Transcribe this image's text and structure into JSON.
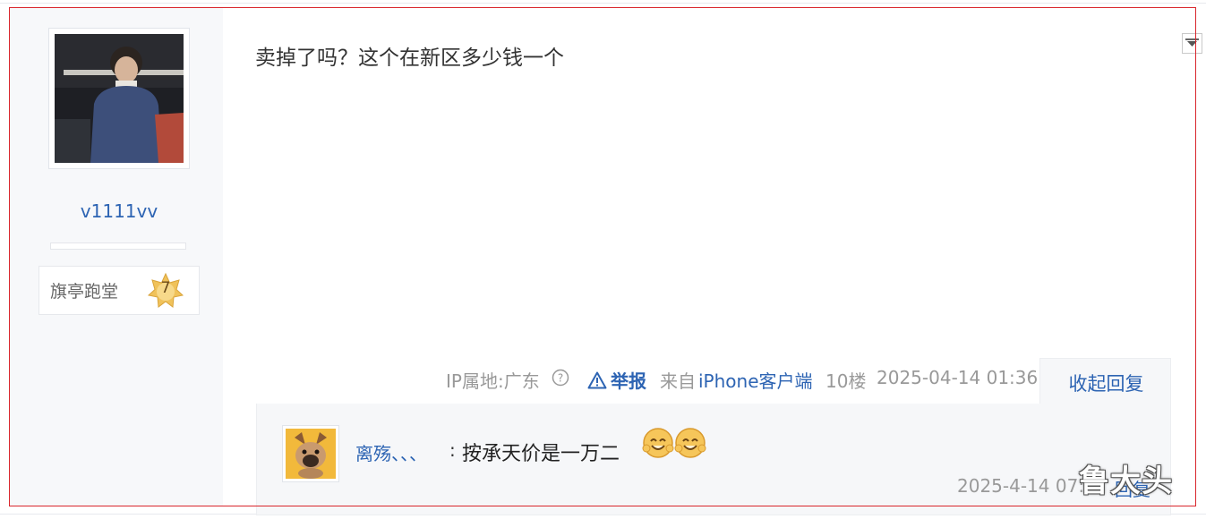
{
  "user": {
    "username": "v1111vv",
    "progress": 0.0,
    "level_title": "旗亭跑堂",
    "level_number": "7"
  },
  "post": {
    "content": "卖掉了吗？这个在新区多少钱一个",
    "meta": {
      "ip_location": "IP属地:广东",
      "help_icon": "question-circle-icon",
      "report": "举报",
      "source_prefix": "来自",
      "source": "iPhone客户端",
      "floor": "10楼",
      "time": "2025-04-14 01:36"
    },
    "collapse_reply_label": "收起回复"
  },
  "replies": [
    {
      "username": "离殇、、、",
      "colon": ":",
      "text": "按承天价是一万二",
      "emojis": [
        "smile-emoji",
        "smile-emoji"
      ],
      "time": "2025-4-14 07:",
      "action": "回复"
    }
  ],
  "watermark": "鲁大头",
  "colors": {
    "link": "#2d64b3",
    "meta": "#999999",
    "frame": "#d9262c",
    "sidebar_bg": "#f7f8fa"
  }
}
